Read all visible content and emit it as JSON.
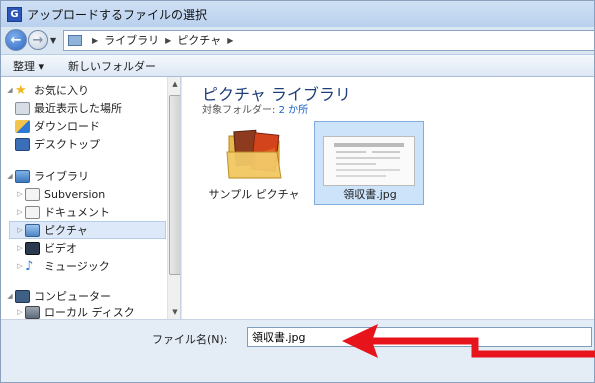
{
  "window": {
    "title": "アップロードするファイルの選択",
    "app_icon_letter": "G"
  },
  "address": {
    "path": [
      "ライブラリ",
      "ピクチャ"
    ]
  },
  "toolbar": {
    "organize": "整理 ▾",
    "new_folder": "新しいフォルダー"
  },
  "sidebar": {
    "favorites": "お気に入り",
    "recent": "最近表示した場所",
    "downloads": "ダウンロード",
    "desktop": "デスクトップ",
    "libraries": "ライブラリ",
    "subversion": "Subversion",
    "documents": "ドキュメント",
    "pictures": "ピクチャ",
    "videos": "ビデオ",
    "music": "ミュージック",
    "computer": "コンピューター",
    "local_disk": "ローカル ディスク"
  },
  "main": {
    "library_title": "ピクチャ ライブラリ",
    "target_prefix": "対象フォルダー:",
    "target_count": "2 か所",
    "files": [
      {
        "name": "サンプル ピクチャ",
        "type": "folder"
      },
      {
        "name": "領収書.jpg",
        "type": "image"
      }
    ]
  },
  "bottom": {
    "filename_label": "ファイル名(N):",
    "filename_value": "領収書.jpg"
  },
  "colors": {
    "annotation_arrow": "#e8141c",
    "selection": "#cde3fa",
    "library_title": "#1e3d7b"
  }
}
